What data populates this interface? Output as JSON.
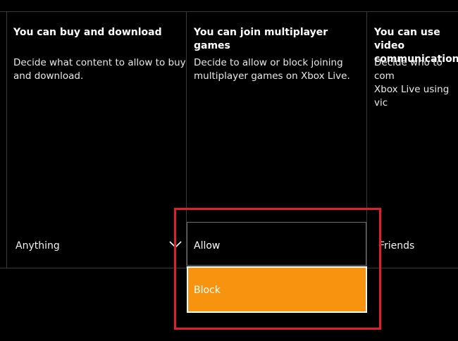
{
  "settings": {
    "columns": [
      {
        "title": "You can buy and download",
        "description": "Decide what content to allow to buy\nand download.",
        "value": "Anything"
      },
      {
        "title": "You can join multiplayer games",
        "description": "Decide to allow or block joining\nmultiplayer games on Xbox Live.",
        "value": ""
      },
      {
        "title": "You can use video\ncommunications",
        "description": "Decide who to com\nXbox Live using vic",
        "value": "Friends"
      }
    ]
  },
  "dropdown": {
    "options": [
      "Allow",
      "Block"
    ],
    "focused_option": "Block"
  },
  "icons": {
    "chevron": "chevron-down-icon"
  },
  "colors": {
    "background": "#000000",
    "focus_orange": "#f7930e",
    "highlight_red": "#e11f2b",
    "divider": "#3a3a3a"
  }
}
